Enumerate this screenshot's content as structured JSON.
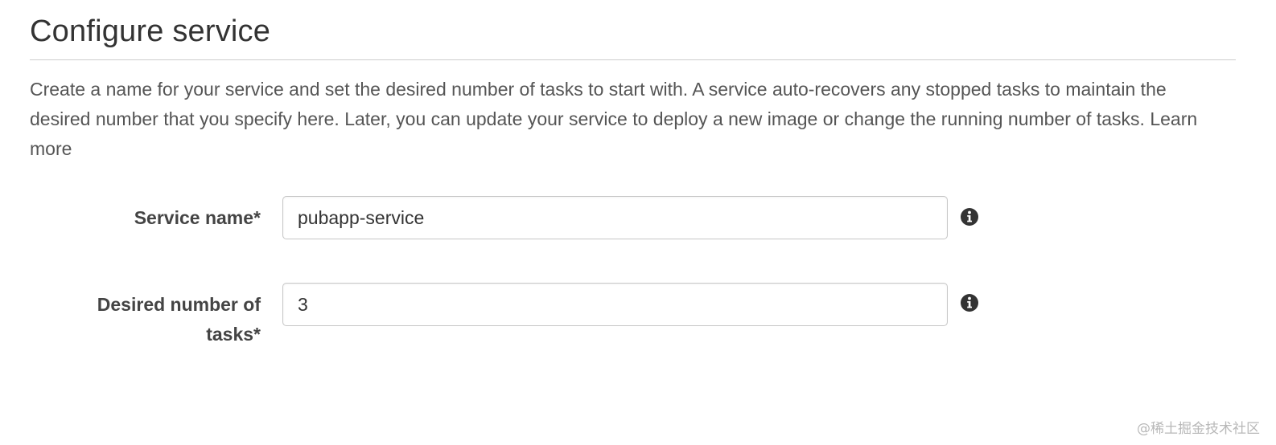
{
  "section": {
    "title": "Configure service",
    "description": "Create a name for your service and set the desired number of tasks to start with. A service auto-recovers any stopped tasks to maintain the desired number that you specify here. Later, you can update your service to deploy a new image or change the running number of tasks.",
    "learn_more": "Learn more"
  },
  "form": {
    "service_name": {
      "label": "Service name*",
      "value": "pubapp-service"
    },
    "desired_tasks": {
      "label_line1": "Desired number of",
      "label_line2": "tasks*",
      "value": "3"
    }
  },
  "icons": {
    "info": "info-circle-icon"
  },
  "colors": {
    "text": "#444444",
    "border": "#c6c6c6",
    "divider": "#cccccc",
    "info_icon": "#333333"
  },
  "watermark": "@稀土掘金技术社区"
}
